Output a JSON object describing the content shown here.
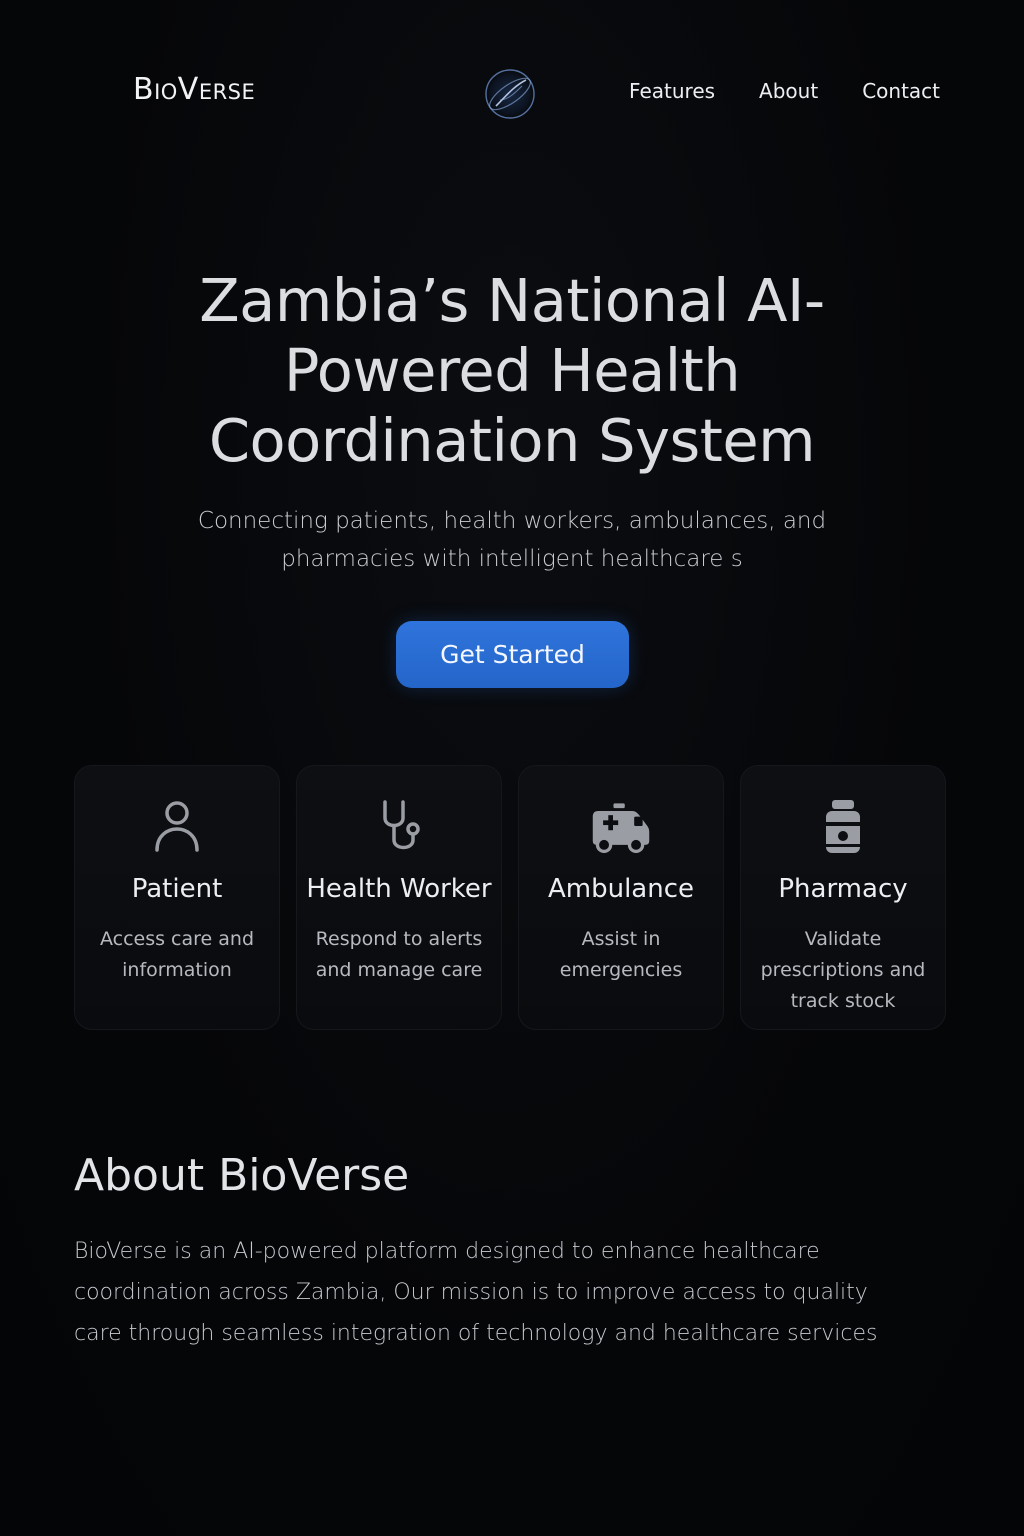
{
  "nav": {
    "brand": "BioVerse",
    "logo_icon": "orb-logo-icon",
    "links": [
      "Features",
      "About",
      "Contact"
    ]
  },
  "hero": {
    "title": "Zambia’s National AI-Powered Health Coordination System",
    "subtitle": "Connecting patients, health workers, ambulances, and pharmacies with intelligent healthcare s",
    "cta_label": "Get Started"
  },
  "cards": [
    {
      "icon": "person-icon",
      "title": "Patient",
      "desc": "Access care and information"
    },
    {
      "icon": "stethoscope-icon",
      "title": "Health Worker",
      "desc": "Respond to alerts and manage care"
    },
    {
      "icon": "ambulance-icon",
      "title": "Ambulance",
      "desc": "Assist in emergencies"
    },
    {
      "icon": "pill-bottle-icon",
      "title": "Pharmacy",
      "desc": "Validate prescriptions and track stock"
    }
  ],
  "about": {
    "title": "About BioVerse",
    "body": "BioVerse is an AI-powered platform designed to enhance healthcare coordination across Zambia, Our mission is to improve access to quality care through seamless integration of technology and healthcare services"
  },
  "colors": {
    "background": "#050608",
    "accent": "#2a6fd6",
    "card": "#0c0e12"
  }
}
